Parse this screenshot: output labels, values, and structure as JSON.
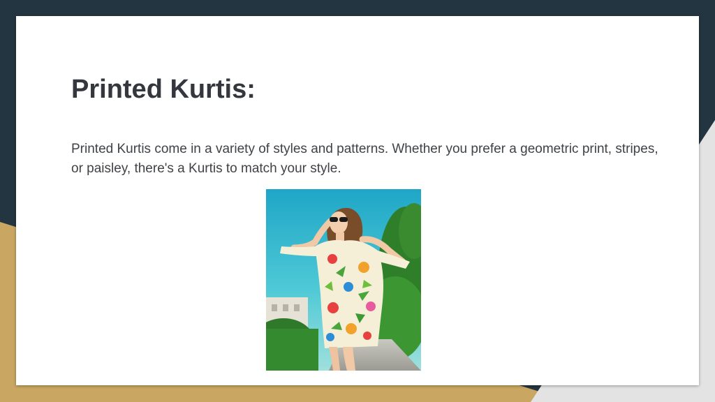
{
  "slide": {
    "title": "Printed Kurtis:",
    "body": "Printed Kurtis come in a variety of styles and patterns. Whether you prefer a geometric print, stripes, or paisley, there's a Kurtis to match your style."
  },
  "image": {
    "subject": "woman in floral printed kurti with sunglasses"
  },
  "colors": {
    "background_dark": "#233540",
    "accent_gold": "#c9a661",
    "accent_gray": "#e3e3e3",
    "title": "#34373d",
    "body_text": "#3f4246"
  }
}
